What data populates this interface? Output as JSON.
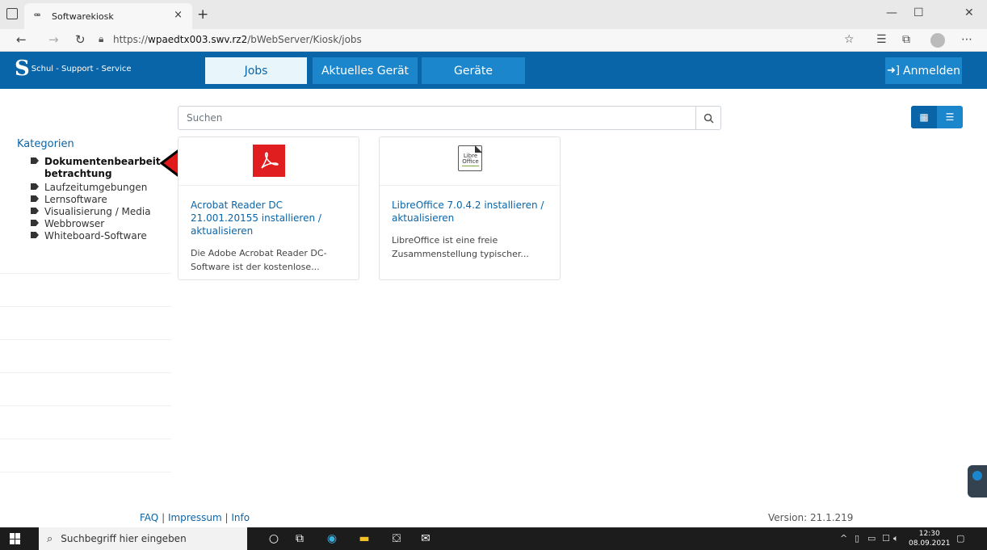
{
  "browser": {
    "tab_title": "Softwarekiosk",
    "tab_close": "×",
    "new_tab": "+",
    "url_scheme": "https://",
    "url_host": "wpaedtx003.swv.rz2",
    "url_path": "/bWebServer/Kiosk/jobs"
  },
  "header": {
    "logo_mark": "S",
    "logo_text": "Schul - Support - Service",
    "tabs": [
      {
        "label": "Jobs"
      },
      {
        "label": "Aktuelles Gerät"
      },
      {
        "label": "Geräte"
      }
    ],
    "login_label": "Anmelden"
  },
  "search": {
    "placeholder": "Suchen"
  },
  "sidebar": {
    "title": "Kategorien",
    "items": [
      {
        "label": "Dokumentenbearbeit... betrachtung"
      },
      {
        "label": "Laufzeitumgebungen"
      },
      {
        "label": "Lernsoftware"
      },
      {
        "label": "Visualisierung / Media"
      },
      {
        "label": "Webbrowser"
      },
      {
        "label": "Whiteboard-Software"
      }
    ]
  },
  "cards": [
    {
      "title": "Acrobat Reader DC 21.001.20155 installieren / aktualisieren",
      "description": "Die Adobe Acrobat Reader DC-Software ist der kostenlose...",
      "icon": "acrobat-reader-icon"
    },
    {
      "title": "LibreOffice 7.0.4.2 installieren / aktualisieren",
      "description": "LibreOffice ist eine freie Zusammenstellung typischer...",
      "icon": "libreoffice-icon",
      "logo_text": "Libre Office"
    }
  ],
  "footer": {
    "faq": "FAQ",
    "sep": "|",
    "impressum": "Impressum",
    "info": "Info",
    "version": "Version: 21.1.219"
  },
  "taskbar": {
    "search_placeholder": "Suchbegriff hier eingeben",
    "time": "12:30",
    "date": "08.09.2021"
  },
  "colors": {
    "brand_blue": "#0a65a8",
    "accent_blue": "#1b86cc",
    "arrow_red": "#e2191b"
  }
}
